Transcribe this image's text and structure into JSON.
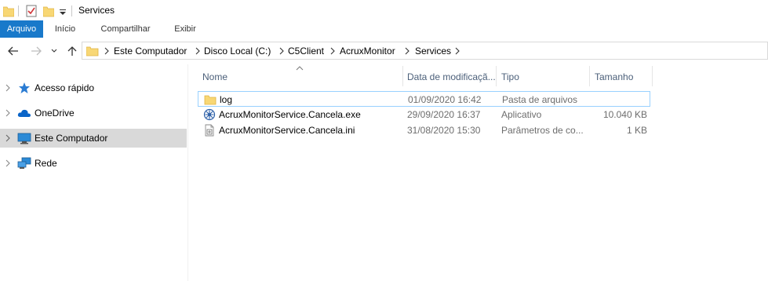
{
  "window": {
    "title": "Services"
  },
  "ribbon": {
    "tabs": [
      "Arquivo",
      "Início",
      "Compartilhar",
      "Exibir"
    ]
  },
  "address": {
    "crumbs": [
      "Este Computador",
      "Disco Local (C:)",
      "C5Client",
      "AcruxMonitor",
      "Services"
    ]
  },
  "nav": {
    "items": [
      {
        "label": "Acesso rápido",
        "icon": "star-icon"
      },
      {
        "label": "OneDrive",
        "icon": "cloud-icon"
      },
      {
        "label": "Este Computador",
        "icon": "computer-icon"
      },
      {
        "label": "Rede",
        "icon": "network-icon"
      }
    ],
    "selected": "Este Computador"
  },
  "columns": {
    "name": "Nome",
    "date": "Data de modificaçã...",
    "type": "Tipo",
    "size": "Tamanho"
  },
  "files": [
    {
      "name": "log",
      "date": "01/09/2020 16:42",
      "type": "Pasta de arquivos",
      "size": "",
      "icon": "folder-icon"
    },
    {
      "name": "AcruxMonitorService.Cancela.exe",
      "date": "29/09/2020 16:37",
      "type": "Aplicativo",
      "size": "10.040 KB",
      "icon": "exe-icon"
    },
    {
      "name": "AcruxMonitorService.Cancela.ini",
      "date": "31/08/2020 15:30",
      "type": "Parâmetros de co...",
      "size": "1 KB",
      "icon": "ini-file-icon"
    }
  ],
  "colors": {
    "ribbon_file_tab": "#1979ca",
    "selected_nav": "#d9d9d9",
    "hover_row_border": "#99d1ff",
    "column_header_text": "#4c607a"
  }
}
